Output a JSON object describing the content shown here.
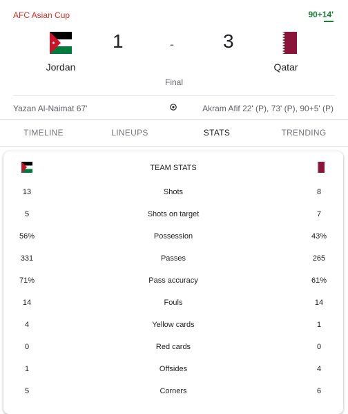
{
  "header": {
    "league": "AFC Asian Cup",
    "time": "90+14'"
  },
  "match": {
    "home": {
      "name": "Jordan",
      "score": "1",
      "flag_icon": "jordan-flag-icon"
    },
    "away": {
      "name": "Qatar",
      "score": "3",
      "flag_icon": "qatar-flag-icon"
    },
    "separator": "-",
    "status": "Final",
    "home_scorers": "Yazan Al-Naimat 67'",
    "away_scorers": "Akram Afif 22' (P), 73' (P), 90+5' (P)",
    "goal_icon": "soccer-ball-icon"
  },
  "tabs": [
    {
      "label": "TIMELINE"
    },
    {
      "label": "LINEUPS"
    },
    {
      "label": "STATS",
      "active": true
    },
    {
      "label": "TRENDING"
    }
  ],
  "stats": {
    "title": "TEAM STATS",
    "rows": [
      {
        "label": "Shots",
        "home": "13",
        "away": "8"
      },
      {
        "label": "Shots on target",
        "home": "5",
        "away": "7"
      },
      {
        "label": "Possession",
        "home": "56%",
        "away": "43%"
      },
      {
        "label": "Passes",
        "home": "331",
        "away": "265"
      },
      {
        "label": "Pass accuracy",
        "home": "71%",
        "away": "61%"
      },
      {
        "label": "Fouls",
        "home": "14",
        "away": "14"
      },
      {
        "label": "Yellow cards",
        "home": "4",
        "away": "1"
      },
      {
        "label": "Red cards",
        "home": "0",
        "away": "0"
      },
      {
        "label": "Offsides",
        "home": "1",
        "away": "4"
      },
      {
        "label": "Corners",
        "home": "5",
        "away": "6"
      }
    ]
  },
  "colors": {
    "league": "#d93025",
    "live": "#188038",
    "jordan_black": "#000000",
    "jordan_green": "#007a3d",
    "jordan_red": "#ce1126",
    "qatar_maroon": "#8a1538"
  }
}
